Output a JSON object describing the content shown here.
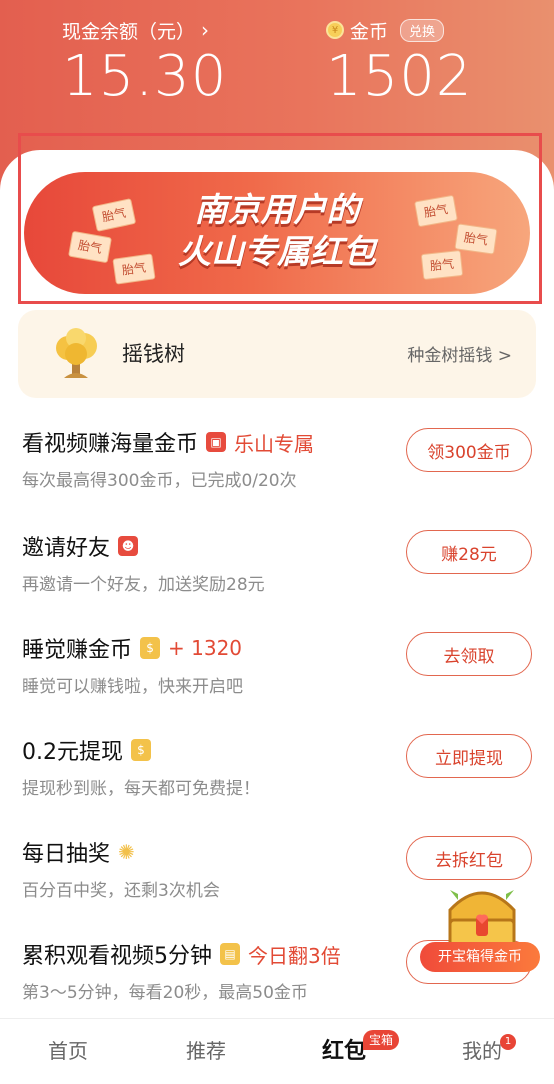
{
  "header": {
    "cash_label": "现金余额（元）",
    "cash_value": "15.30",
    "coin_label": "金币",
    "coin_value": "1502",
    "exchange_label": "兑换"
  },
  "banner": {
    "line1": "南京用户的",
    "line2": "火山专属红包",
    "tag_text": "胎气"
  },
  "money_tree": {
    "name": "摇钱树",
    "link": "种金树摇钱 >"
  },
  "tasks": [
    {
      "title": "看视频赚海量金币",
      "extra": "乐山专属",
      "sub": "每次最高得300金币，已完成0/20次",
      "button": "领300金币"
    },
    {
      "title": "邀请好友",
      "extra": "",
      "sub": "再邀请一个好友，加送奖励28元",
      "button": "赚28元"
    },
    {
      "title": "睡觉赚金币",
      "extra": "+ 1320",
      "sub": "睡觉可以赚钱啦，快来开启吧",
      "button": "去领取"
    },
    {
      "title": "0.2元提现",
      "extra": "",
      "sub": "提现秒到账，每天都可免费提！",
      "button": "立即提现"
    },
    {
      "title": "每日抽奖",
      "extra": "",
      "sub": "百分百中奖，还剩3次机会",
      "button": "去拆红包"
    },
    {
      "title": "累积观看视频5分钟",
      "extra": "今日翻3倍",
      "sub": "第3～5分钟，每看20秒，最高50金币",
      "button": ""
    }
  ],
  "treasure_chest": {
    "label": "开宝箱得金币"
  },
  "tabbar": {
    "items": [
      "首页",
      "推荐",
      "红包",
      "我的"
    ],
    "active": "红包",
    "hongbao_badge": "宝箱",
    "me_badge": "1"
  },
  "colors": {
    "accent": "#e24a35",
    "header_start": "#e35f4f",
    "header_end": "#e9906e"
  }
}
